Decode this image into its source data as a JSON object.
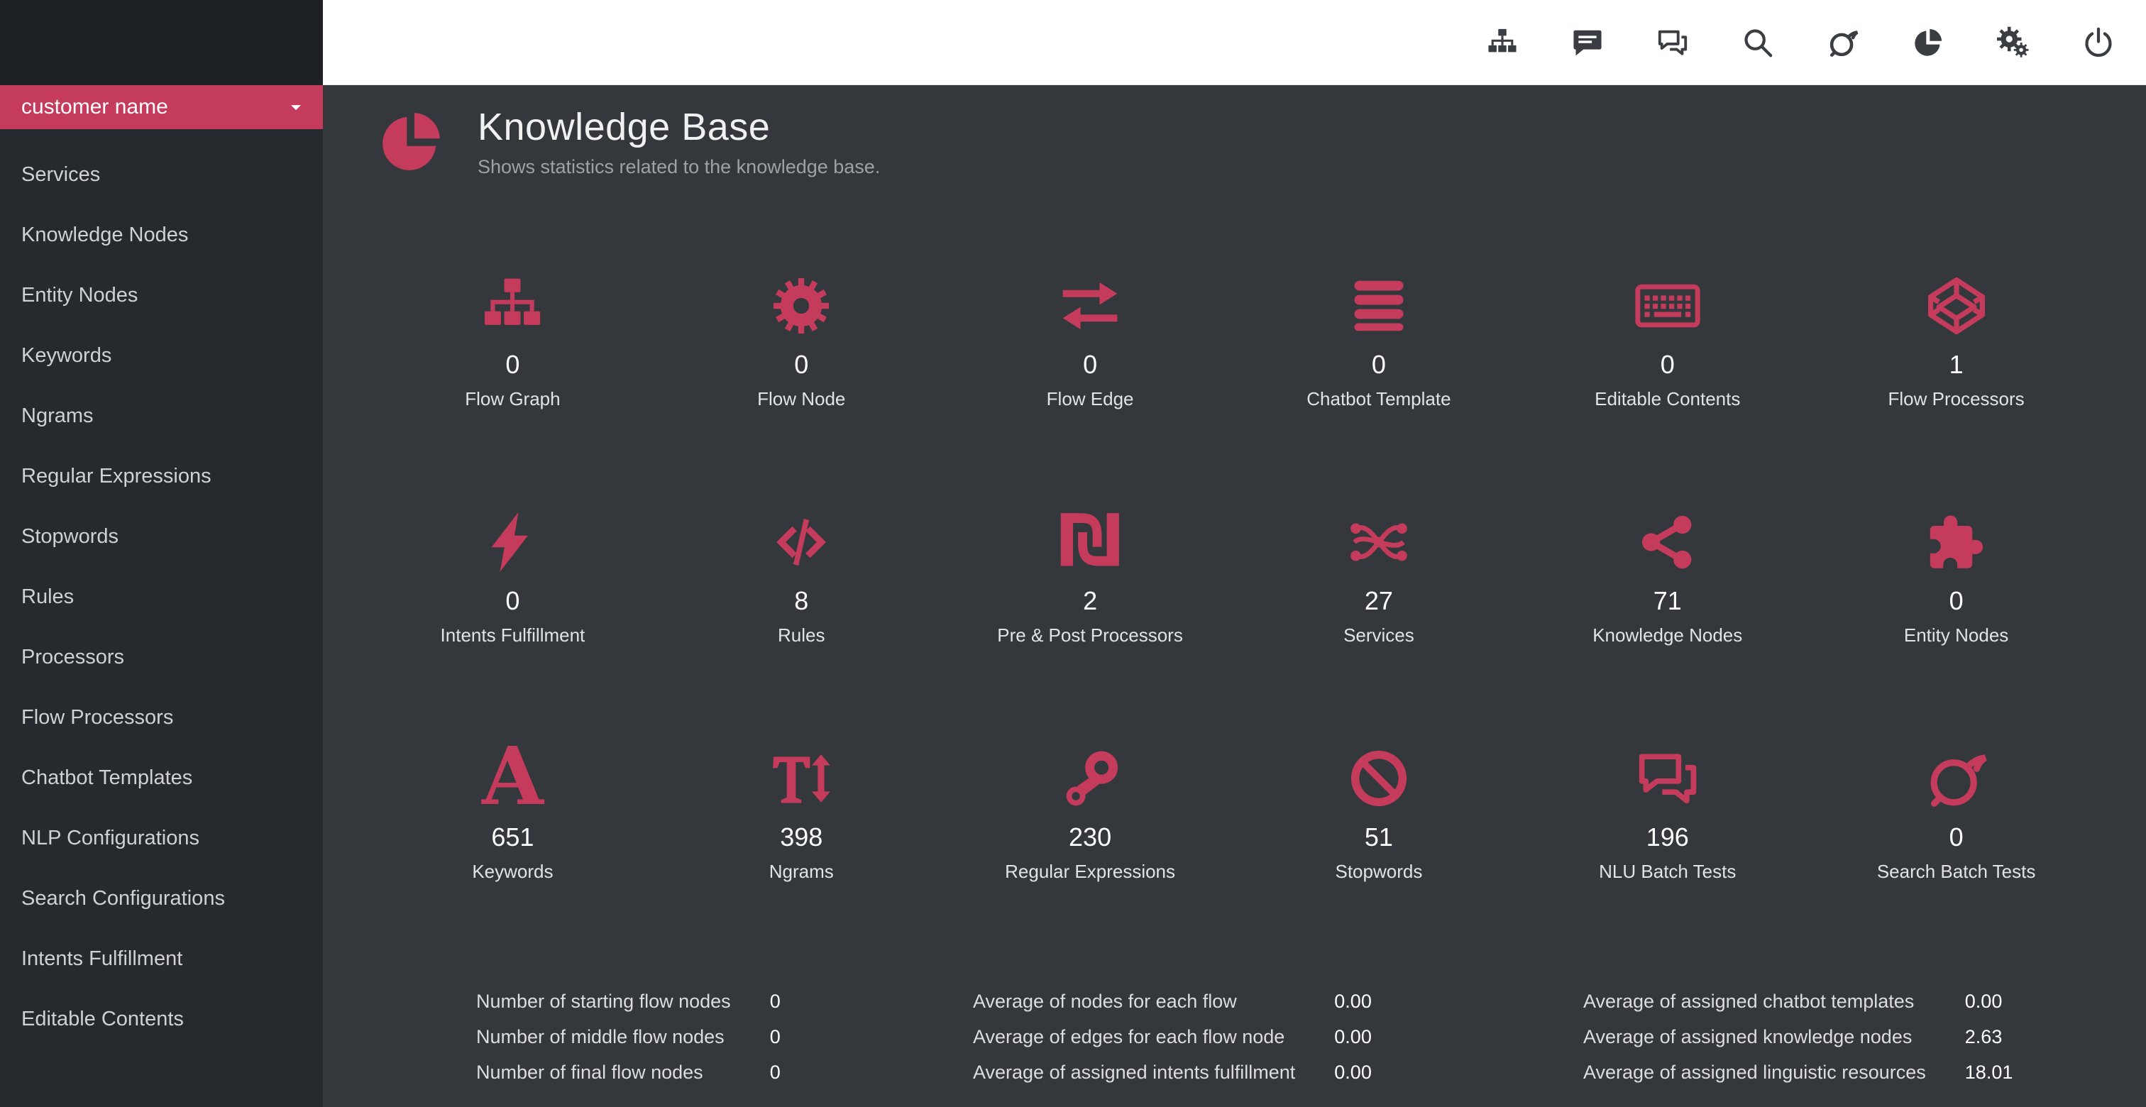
{
  "colors": {
    "accent": "#c43b5c",
    "sidebar_background": "#26292e",
    "main_background": "#34373c",
    "topbar_background": "#ffffff"
  },
  "sidebar": {
    "customer": {
      "label": "customer name"
    },
    "items": [
      {
        "label": "Services"
      },
      {
        "label": "Knowledge Nodes"
      },
      {
        "label": "Entity Nodes"
      },
      {
        "label": "Keywords"
      },
      {
        "label": "Ngrams"
      },
      {
        "label": "Regular Expressions"
      },
      {
        "label": "Stopwords"
      },
      {
        "label": "Rules"
      },
      {
        "label": "Processors"
      },
      {
        "label": "Flow Processors"
      },
      {
        "label": "Chatbot Templates"
      },
      {
        "label": "NLP Configurations"
      },
      {
        "label": "Search Configurations"
      },
      {
        "label": "Intents Fulfillment"
      },
      {
        "label": "Editable Contents"
      }
    ]
  },
  "topbar": {
    "icons": [
      {
        "name": "sitemap-icon"
      },
      {
        "name": "comment-icon"
      },
      {
        "name": "comments-icon"
      },
      {
        "name": "search-icon"
      },
      {
        "name": "swoosh-circle-icon"
      },
      {
        "name": "pie-chart-icon"
      },
      {
        "name": "gears-icon"
      },
      {
        "name": "power-icon"
      }
    ]
  },
  "header": {
    "icon": "pie-chart-icon",
    "title": "Knowledge Base",
    "subtitle": "Shows statistics related to the knowledge base."
  },
  "stats": [
    {
      "value": "0",
      "label": "Flow Graph",
      "icon": "sitemap-icon"
    },
    {
      "value": "0",
      "label": "Flow Node",
      "icon": "flow-node-icon"
    },
    {
      "value": "0",
      "label": "Flow Edge",
      "icon": "flow-edge-icon"
    },
    {
      "value": "0",
      "label": "Chatbot Template",
      "icon": "chatbot-template-icon"
    },
    {
      "value": "0",
      "label": "Editable Contents",
      "icon": "keyboard-icon"
    },
    {
      "value": "1",
      "label": "Flow Processors",
      "icon": "cube-icon"
    },
    {
      "value": "0",
      "label": "Intents Fulfillment",
      "icon": "lightning-icon"
    },
    {
      "value": "8",
      "label": "Rules",
      "icon": "code-icon"
    },
    {
      "value": "2",
      "label": "Pre & Post Processors",
      "icon": "shekel-icon"
    },
    {
      "value": "27",
      "label": "Services",
      "icon": "knot-icon"
    },
    {
      "value": "71",
      "label": "Knowledge Nodes",
      "icon": "share-nodes-icon"
    },
    {
      "value": "0",
      "label": "Entity Nodes",
      "icon": "puzzle-icon"
    },
    {
      "value": "651",
      "label": "Keywords",
      "icon": "font-a-icon"
    },
    {
      "value": "398",
      "label": "Ngrams",
      "icon": "text-height-icon"
    },
    {
      "value": "230",
      "label": "Regular Expressions",
      "icon": "steam-icon"
    },
    {
      "value": "51",
      "label": "Stopwords",
      "icon": "ban-icon"
    },
    {
      "value": "196",
      "label": "NLU Batch Tests",
      "icon": "comments-icon"
    },
    {
      "value": "0",
      "label": "Search Batch Tests",
      "icon": "swoosh-circle-icon"
    }
  ],
  "summary": {
    "columns": [
      {
        "rows": [
          {
            "label": "Number of starting flow nodes",
            "value": "0"
          },
          {
            "label": "Number of middle flow nodes",
            "value": "0"
          },
          {
            "label": "Number of final flow nodes",
            "value": "0"
          }
        ]
      },
      {
        "rows": [
          {
            "label": "Average of nodes for each flow",
            "value": "0.00"
          },
          {
            "label": "Average of edges for each flow node",
            "value": "0.00"
          },
          {
            "label": "Average of assigned intents fulfillment",
            "value": "0.00"
          }
        ]
      },
      {
        "rows": [
          {
            "label": "Average of assigned chatbot templates",
            "value": "0.00"
          },
          {
            "label": "Average of assigned knowledge nodes",
            "value": "2.63"
          },
          {
            "label": "Average of assigned linguistic resources",
            "value": "18.01"
          }
        ]
      }
    ]
  }
}
